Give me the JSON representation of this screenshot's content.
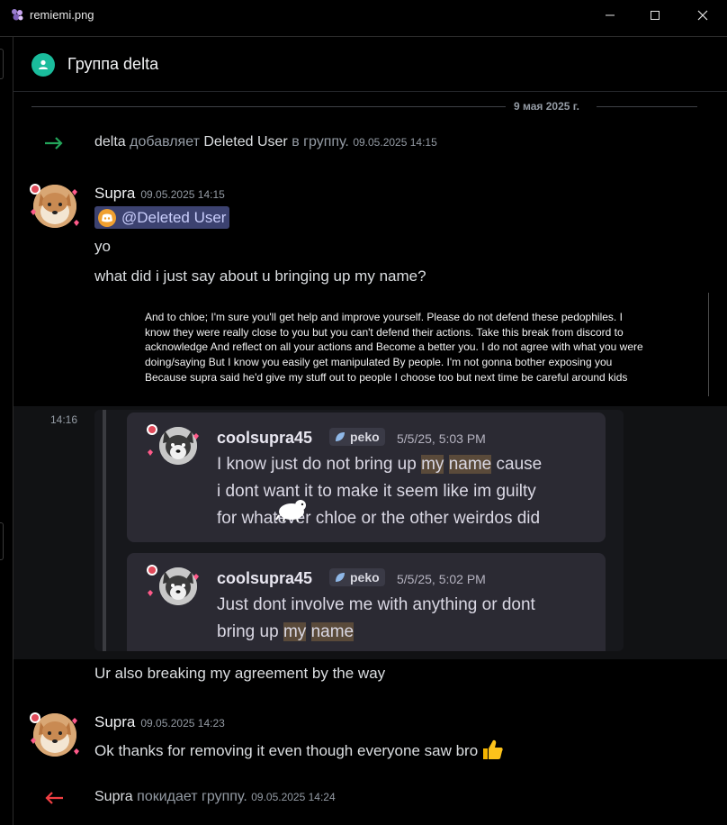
{
  "window": {
    "title": "remiemi.png"
  },
  "header": {
    "title": "Группа delta"
  },
  "date_divider": "9 мая 2025 г.",
  "system_join": {
    "actor": "delta",
    "verb": "добавляет",
    "target": "Deleted User",
    "suffix": "в группу.",
    "timestamp": "09.05.2025 14:15"
  },
  "message1": {
    "author": "Supra",
    "timestamp": "09.05.2025 14:15",
    "mention": "@Deleted User",
    "lines": [
      "yo",
      "what did i just say about u bringing up my name?"
    ]
  },
  "embed_text": "And to chloe; I'm sure you'll get help and improve yourself. Please do not defend these pedophiles. I know they were really close to you but you can't defend their actions. Take this break from discord to acknowledge And reflect on all your actions and Become a better you. I do not agree with what you were doing/saying But I know you easily get manipulated By people. I'm not gonna bother exposing you Because supra said he'd give my stuff out to people I choose too but next time be careful around kids",
  "hover_timestamp": "14:16",
  "quoted": [
    {
      "name": "coolsupra45",
      "tag": "peko",
      "time": "5/5/25, 5:03 PM",
      "line1_pre": "I know just do not bring up ",
      "line1_hl1": "my",
      "line1_hl2": "name",
      "line1_post": " cause",
      "line2": "i dont want it to make it seem like im guilty",
      "line3": "for whatever chloe or the other weirdos did"
    },
    {
      "name": "coolsupra45",
      "tag": "peko",
      "time": "5/5/25, 5:02 PM",
      "line1": "Just dont involve me with anything or dont",
      "line2_pre": "bring up ",
      "line2_hl1": "my",
      "line2_hl2": "name"
    }
  ],
  "message1_tail": "Ur also breaking my agreement by the way",
  "message2": {
    "author": "Supra",
    "timestamp": "09.05.2025 14:23",
    "text": "Ok thanks for removing it even though everyone saw bro"
  },
  "system_leave": {
    "actor": "Supra",
    "verb": "покидает группу.",
    "timestamp": "09.05.2025 14:24"
  },
  "colors": {
    "join_arrow": "#23a55a",
    "leave_arrow": "#f23f43",
    "group_icon": "#1abc9c",
    "mention_bg": "#3c4270"
  },
  "icons": [
    "app-icon",
    "minimize-icon",
    "maximize-icon",
    "close-icon",
    "group-icon",
    "join-arrow-icon",
    "leave-arrow-icon",
    "discord-icon",
    "leaf-icon",
    "thumbs-up-icon"
  ]
}
